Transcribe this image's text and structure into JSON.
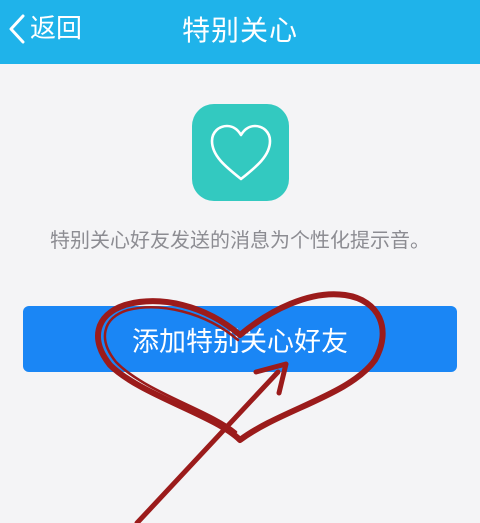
{
  "header": {
    "back_label": "返回",
    "title": "特别关心"
  },
  "main": {
    "icon": "heart-icon",
    "description": "特别关心好友发送的消息为个性化提示音。",
    "add_button_label": "添加特别关心好友"
  },
  "colors": {
    "header_bg": "#1fb3ea",
    "icon_bg": "#33c9c0",
    "button_bg": "#1a86f5",
    "annotation": "#9b1b1b"
  }
}
